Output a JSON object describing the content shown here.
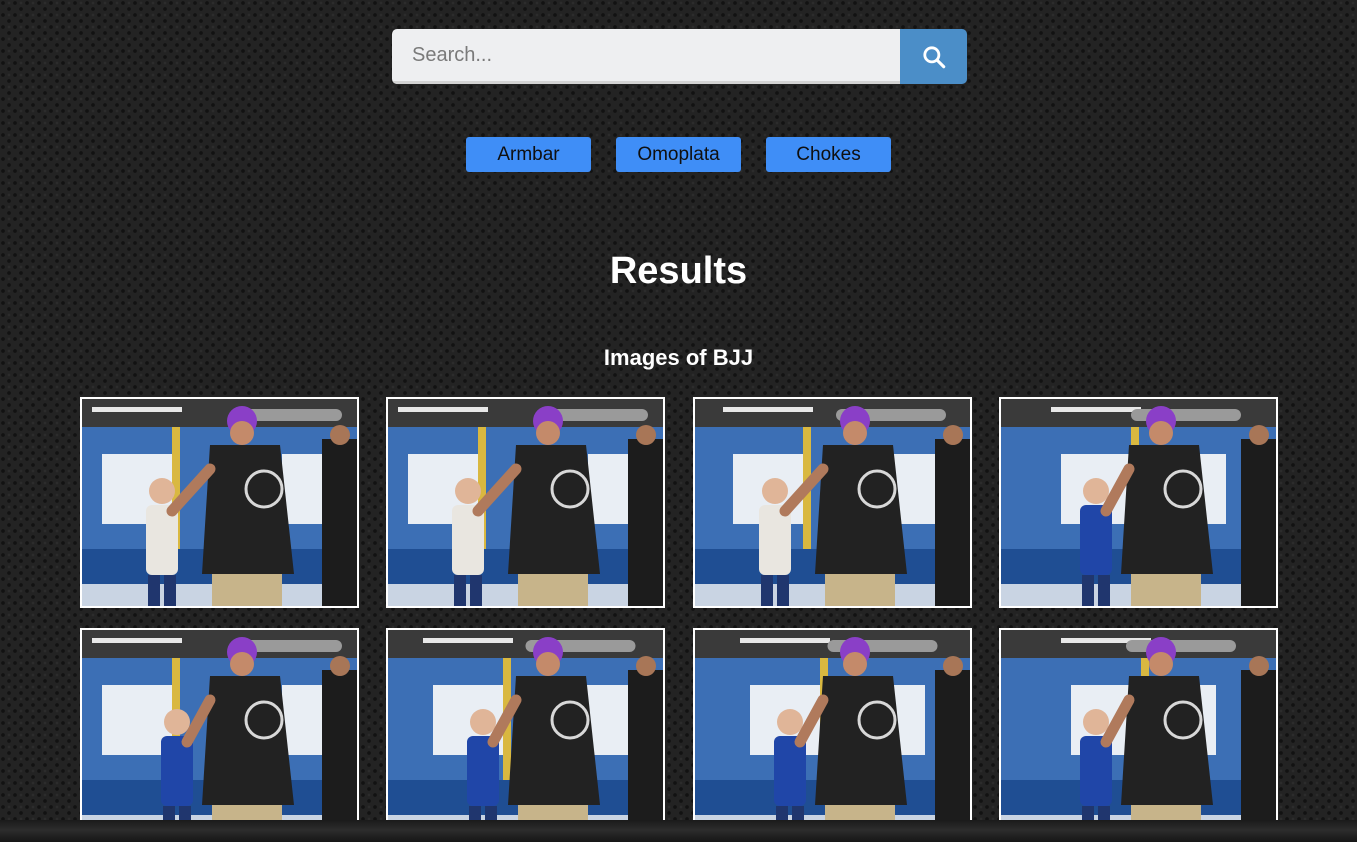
{
  "search": {
    "placeholder": "Search...",
    "icon": "search-icon"
  },
  "tags": [
    {
      "label": "Armbar"
    },
    {
      "label": "Omoplata"
    },
    {
      "label": "Chokes"
    }
  ],
  "results": {
    "title": "Results"
  },
  "gallery": {
    "title": "Images of BJJ",
    "images": [
      {
        "subject": "girl"
      },
      {
        "subject": "girl"
      },
      {
        "subject": "girl"
      },
      {
        "subject": "boy"
      },
      {
        "subject": "boy"
      },
      {
        "subject": "boy"
      },
      {
        "subject": "boy"
      },
      {
        "subject": "boy"
      }
    ]
  },
  "colors": {
    "background": "#232323",
    "search_button": "#4b8ec8",
    "tag_button": "#3f8ef7",
    "search_field": "#eeeff1"
  }
}
